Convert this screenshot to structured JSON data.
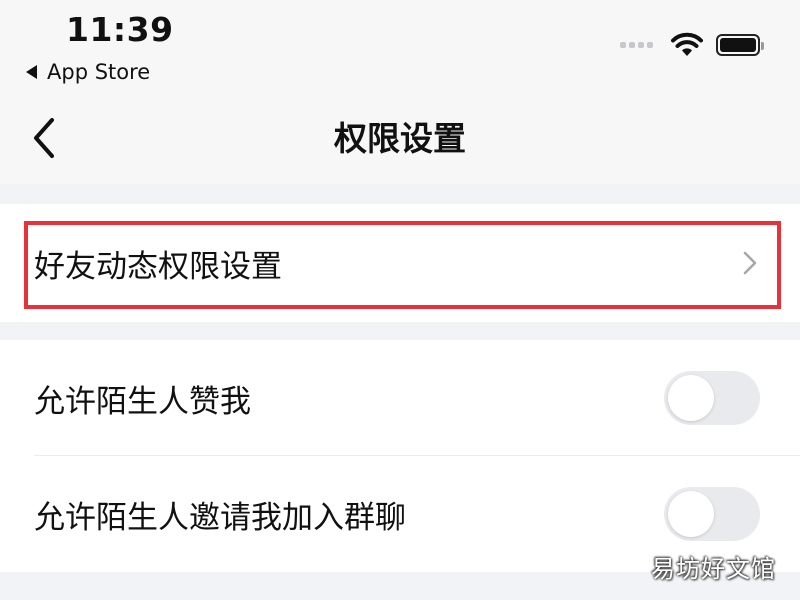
{
  "status_bar": {
    "time": "11:39",
    "back_app_label": "App Store"
  },
  "nav": {
    "title": "权限设置"
  },
  "section1": {
    "items": [
      {
        "label": "好友动态权限设置"
      }
    ]
  },
  "section2": {
    "items": [
      {
        "label": "允许陌生人赞我",
        "enabled": false
      },
      {
        "label": "允许陌生人邀请我加入群聊",
        "enabled": false
      }
    ]
  },
  "watermark": "易坊好文馆",
  "colors": {
    "highlight": "#e53339",
    "toggle_off": "#e9eaee",
    "background": "#f2f3f6"
  },
  "icons": {
    "back": "chevron-left-icon",
    "row_arrow": "chevron-right-icon",
    "wifi": "wifi-icon",
    "battery": "battery-icon"
  }
}
